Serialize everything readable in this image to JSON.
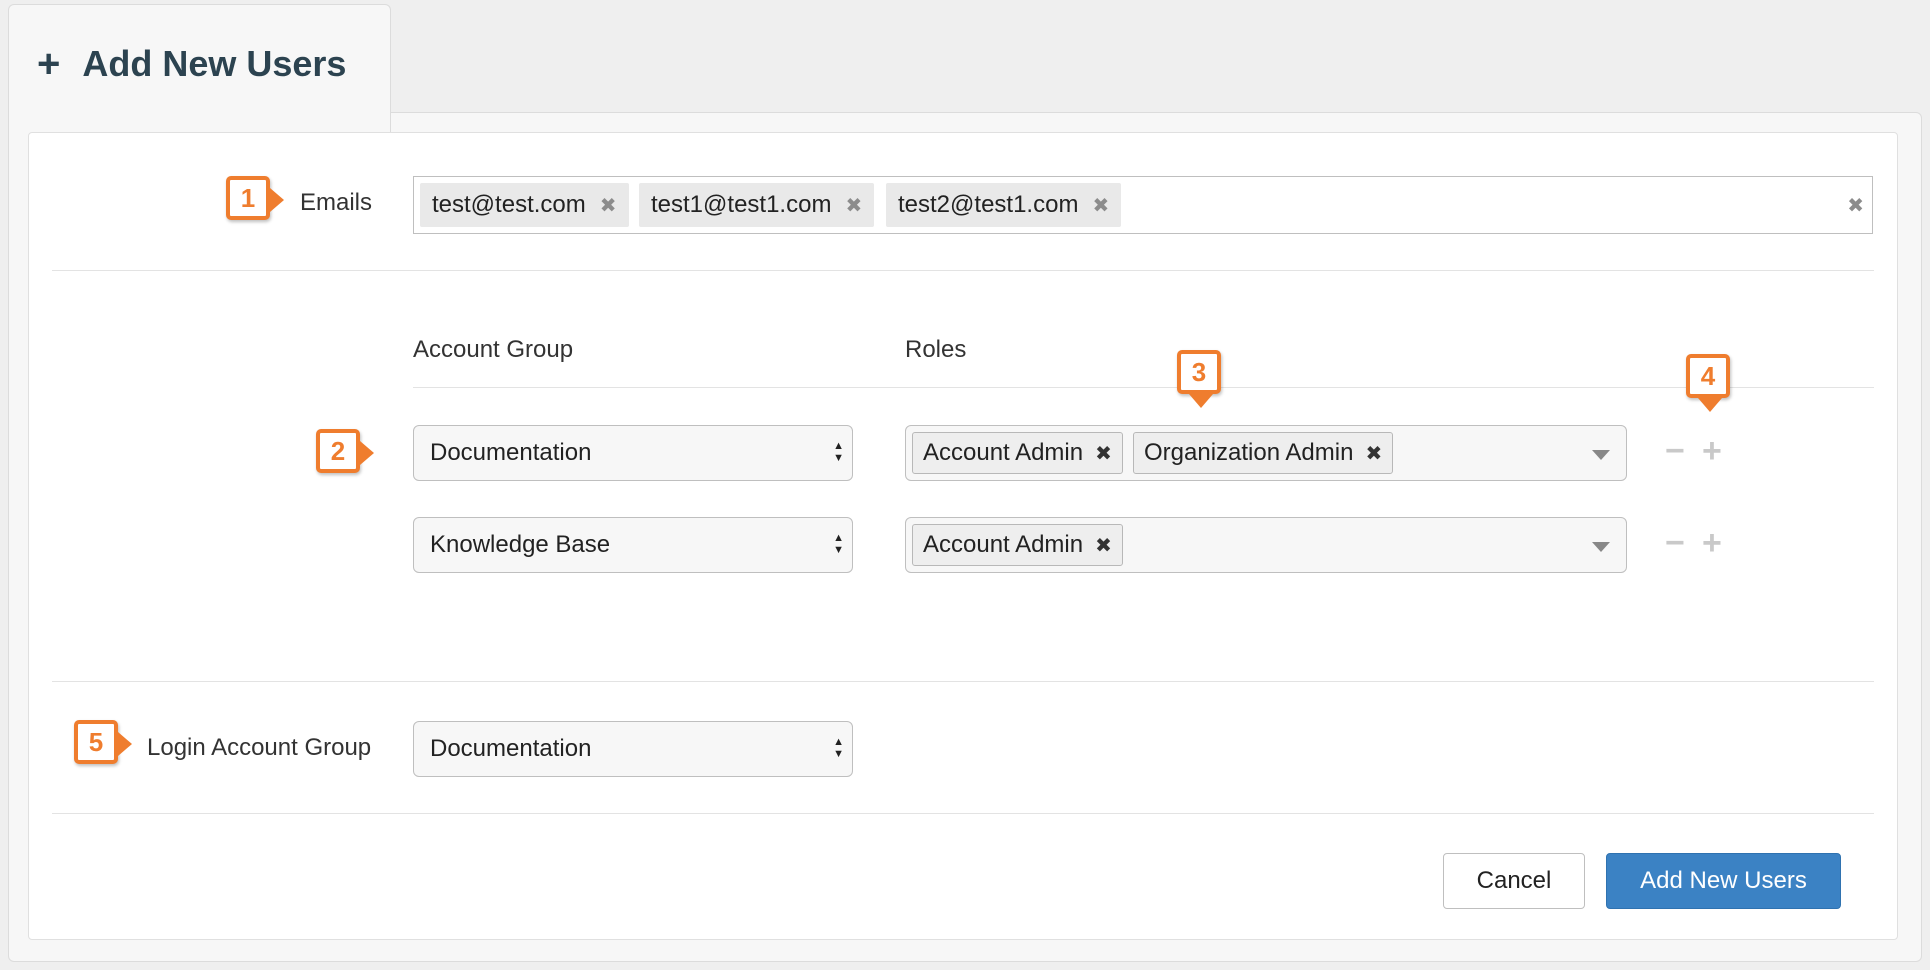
{
  "tab": {
    "title": "Add New Users",
    "icon": "plus-icon"
  },
  "callouts": [
    "1",
    "2",
    "3",
    "4",
    "5"
  ],
  "emails": {
    "label": "Emails",
    "chips": [
      "test@test.com",
      "test1@test1.com",
      "test2@test1.com"
    ],
    "remove_glyph": "✖",
    "clear_glyph": "✖"
  },
  "groups": {
    "headers": {
      "account_group": "Account Group",
      "roles": "Roles"
    },
    "rows": [
      {
        "account_group": "Documentation",
        "roles": [
          "Account Admin",
          "Organization Admin"
        ]
      },
      {
        "account_group": "Knowledge Base",
        "roles": [
          "Account Admin"
        ]
      }
    ],
    "minus_glyph": "−",
    "plus_glyph": "+"
  },
  "login": {
    "label": "Login Account Group",
    "value": "Documentation"
  },
  "buttons": {
    "cancel": "Cancel",
    "submit": "Add New Users"
  },
  "colors": {
    "accent": "#3b82c4",
    "callout": "#ef7d2e",
    "title": "#2c4350"
  }
}
